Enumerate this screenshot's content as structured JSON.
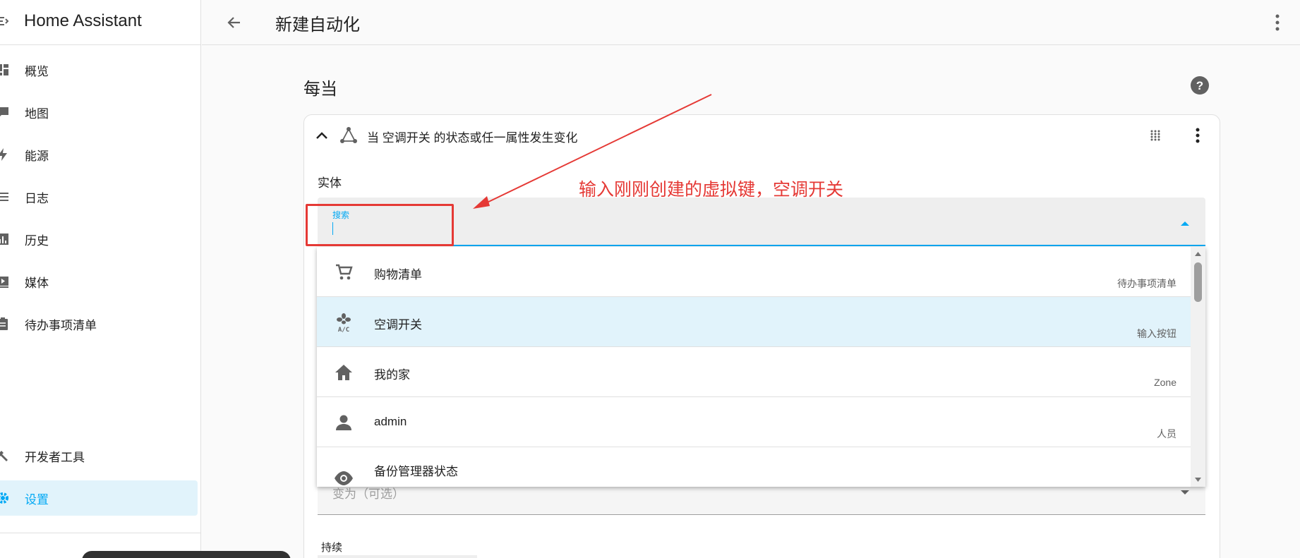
{
  "sidebar": {
    "title": "Home Assistant",
    "items": [
      {
        "label": "概览",
        "icon": "dashboard-icon"
      },
      {
        "label": "地图",
        "icon": "map-icon"
      },
      {
        "label": "能源",
        "icon": "lightning-icon"
      },
      {
        "label": "日志",
        "icon": "list-icon"
      },
      {
        "label": "历史",
        "icon": "chart-icon"
      },
      {
        "label": "媒体",
        "icon": "play-box-icon"
      },
      {
        "label": "待办事项清单",
        "icon": "clipboard-icon"
      }
    ],
    "bottom_items": [
      {
        "label": "开发者工具",
        "icon": "hammer-icon"
      },
      {
        "label": "设置",
        "icon": "gear-icon",
        "active": true
      }
    ],
    "active_color": "#03a9f4"
  },
  "topbar": {
    "title": "新建自动化"
  },
  "section": {
    "title": "每当"
  },
  "trigger_card": {
    "heading": "当 空调开关 的状态或任一属性发生变化",
    "entity_label": "实体",
    "search_label": "搜索",
    "to_label": "变为（可选）",
    "for_label": "持续"
  },
  "annotation": {
    "text": "输入刚刚创建的虚拟键，空调开关",
    "color": "#e53935"
  },
  "dropdown": {
    "items": [
      {
        "name": "购物清单",
        "context": "待办事项清单",
        "icon": "cart-icon",
        "selected": false
      },
      {
        "name": "空调开关",
        "context": "输入按钮",
        "icon": "air-conditioner-icon",
        "selected": true
      },
      {
        "name": "我的家",
        "context": "Zone",
        "icon": "home-icon",
        "selected": false
      },
      {
        "name": "admin",
        "context": "人员",
        "icon": "person-icon",
        "selected": false
      },
      {
        "name": "备份管理器状态",
        "context": "",
        "icon": "eye-icon",
        "selected": false
      }
    ]
  }
}
